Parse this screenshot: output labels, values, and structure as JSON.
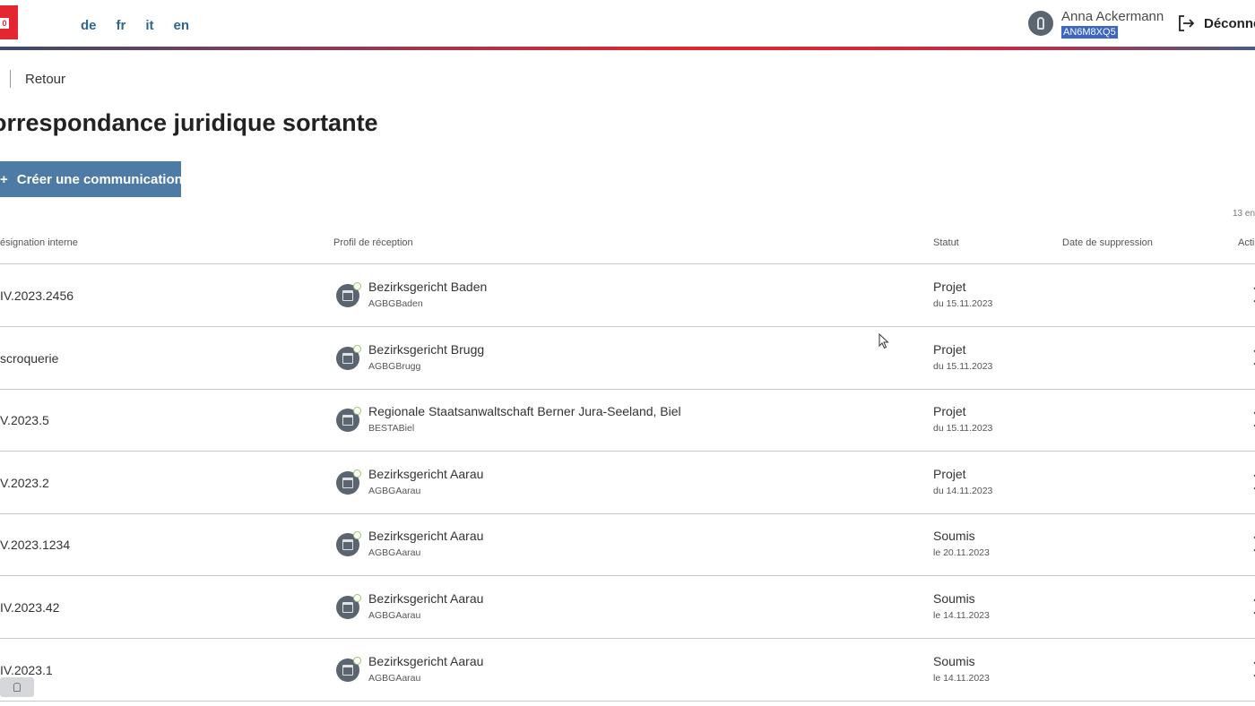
{
  "header": {
    "logo_text": "0",
    "languages": [
      "de",
      "fr",
      "it",
      "en"
    ],
    "user": {
      "name": "Anna Ackermann",
      "id": "AN6M8XQ5"
    },
    "logout_label": "Déconne"
  },
  "nav": {
    "back_label": "Retour"
  },
  "page": {
    "title": "orrespondance juridique sortante",
    "create_button_label": "Créer une communication",
    "create_button_icon": "+",
    "count_text": "13 en"
  },
  "table": {
    "columns": [
      "ésignation interne",
      "Profil de réception",
      "Statut",
      "Date de suppression",
      "Acti"
    ],
    "rows": [
      {
        "designation": "IV.2023.2456",
        "profile_name": "Bezirksgericht Baden",
        "profile_code": "AGBGBaden",
        "status": "Projet",
        "status_date": "du 15.11.2023"
      },
      {
        "designation": "scroquerie",
        "profile_name": "Bezirksgericht Brugg",
        "profile_code": "AGBGBrugg",
        "status": "Projet",
        "status_date": "du 15.11.2023"
      },
      {
        "designation": "V.2023.5",
        "profile_name": "Regionale Staatsanwaltschaft Berner Jura-Seeland, Biel",
        "profile_code": "BESTABiel",
        "status": "Projet",
        "status_date": "du 15.11.2023"
      },
      {
        "designation": "V.2023.2",
        "profile_name": "Bezirksgericht Aarau",
        "profile_code": "AGBGAarau",
        "status": "Projet",
        "status_date": "du 14.11.2023"
      },
      {
        "designation": "V.2023.1234",
        "profile_name": "Bezirksgericht Aarau",
        "profile_code": "AGBGAarau",
        "status": "Soumis",
        "status_date": "le 20.11.2023"
      },
      {
        "designation": "IV.2023.42",
        "profile_name": "Bezirksgericht Aarau",
        "profile_code": "AGBGAarau",
        "status": "Soumis",
        "status_date": "le 14.11.2023"
      },
      {
        "designation": "IV.2023.1",
        "profile_name": "Bezirksgericht Aarau",
        "profile_code": "AGBGAarau",
        "status": "Soumis",
        "status_date": "le 14.11.2023"
      }
    ]
  },
  "colors": {
    "accent": "#4d7ba6",
    "brand_red": "#e3262f",
    "link": "#2f6591"
  },
  "icons": {
    "court": "courthouse-icon",
    "logout": "logout-icon",
    "user": "user-avatar-icon",
    "row_action": "chevron-right-icon"
  }
}
